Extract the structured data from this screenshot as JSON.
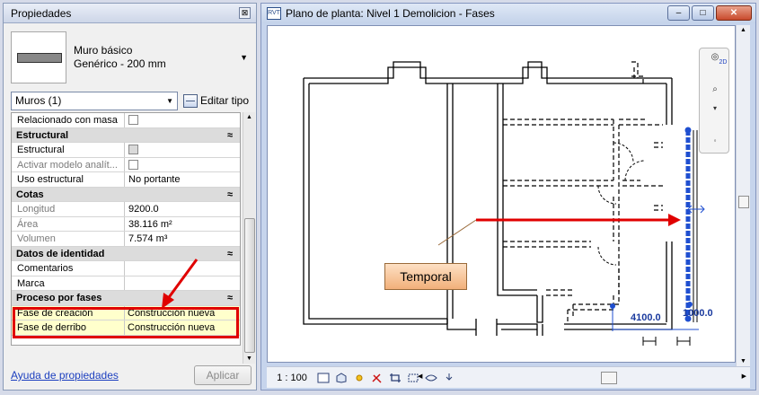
{
  "properties_panel": {
    "title": "Propiedades",
    "close_glyph": "⊠",
    "type_name_line1": "Muro básico",
    "type_name_line2": "Genérico - 200 mm",
    "instance_selector": "Muros (1)",
    "edit_type_label": "Editar tipo",
    "rows": [
      {
        "kind": "row",
        "key": "Relacionado con masa",
        "value": "",
        "check": "empty",
        "dim": false
      },
      {
        "kind": "group",
        "key": "Estructural"
      },
      {
        "kind": "row",
        "key": "Estructural",
        "value": "",
        "check": "gray",
        "dim": false
      },
      {
        "kind": "row",
        "key": "Activar modelo analít...",
        "value": "",
        "check": "empty",
        "dim": true
      },
      {
        "kind": "row",
        "key": "Uso estructural",
        "value": "No portante",
        "check": "",
        "dim": false
      },
      {
        "kind": "group",
        "key": "Cotas"
      },
      {
        "kind": "row",
        "key": "Longitud",
        "value": "9200.0",
        "check": "",
        "dim": true
      },
      {
        "kind": "row",
        "key": "Área",
        "value": "38.116 m²",
        "check": "",
        "dim": true
      },
      {
        "kind": "row",
        "key": "Volumen",
        "value": "7.574 m³",
        "check": "",
        "dim": true
      },
      {
        "kind": "group",
        "key": "Datos de identidad"
      },
      {
        "kind": "row",
        "key": "Comentarios",
        "value": "",
        "check": "",
        "dim": false
      },
      {
        "kind": "row",
        "key": "Marca",
        "value": "",
        "check": "",
        "dim": false
      },
      {
        "kind": "group",
        "key": "Proceso por fases"
      },
      {
        "kind": "phase",
        "key": "Fase de creación",
        "value": "Construcción nueva"
      },
      {
        "kind": "phase",
        "key": "Fase de derribo",
        "value": "Construcción nueva"
      }
    ],
    "collapse_glyph": "≈",
    "help_link": "Ayuda de propiedades",
    "apply_button": "Aplicar"
  },
  "view_window": {
    "title": "Plano de planta: Nivel 1 Demolicion - Fases",
    "app_icon_text": "RVT",
    "buttons": {
      "minimize": "–",
      "maximize": "□",
      "close": "✕"
    },
    "callout_label": "Temporal",
    "dimension_1": "4100.0",
    "dimension_2": "1000.0",
    "scale": "1 : 100",
    "nav_2d": "2D"
  },
  "colors": {
    "highlight_border": "#e00000",
    "phase_row_bg": "#ffffcc",
    "selected_wall": "#1f4fd0",
    "arrow_red": "#e00000",
    "callout_fill": "#f2b07a"
  }
}
